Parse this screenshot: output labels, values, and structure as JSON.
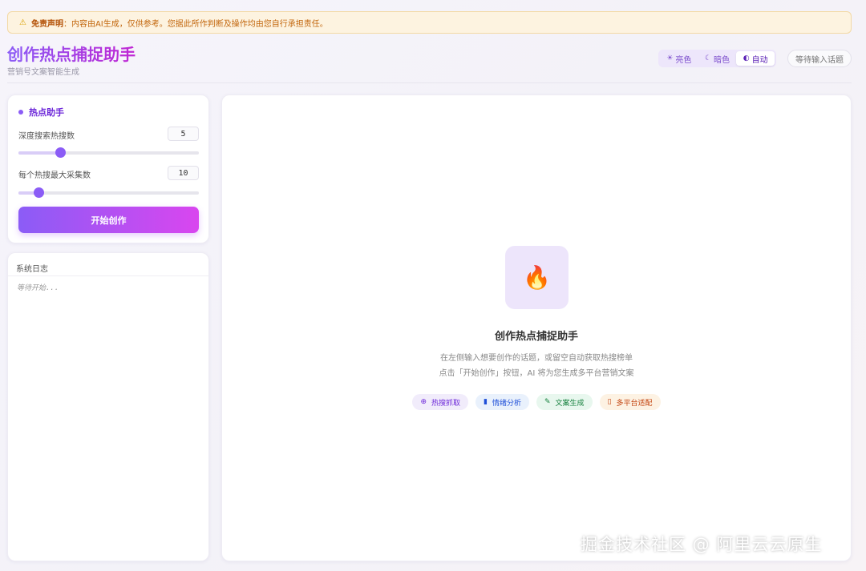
{
  "disclaimer": {
    "label": "免责声明",
    "text": "：内容由AI生成，仅供参考。您据此所作判断及操作均由您自行承担责任。"
  },
  "header": {
    "title": "创作热点捕捉助手",
    "subtitle": "营销号文案智能生成",
    "themes": [
      {
        "label": "亮色",
        "icon": "sun-icon"
      },
      {
        "label": "暗色",
        "icon": "moon-icon"
      },
      {
        "label": "自动",
        "icon": "half-circle-icon"
      }
    ],
    "active_theme": "自动",
    "status": "等待输入话题"
  },
  "settings": {
    "title": "热点助手",
    "depth": {
      "label": "深度搜索热搜数",
      "value": "5",
      "fraction": 0.23
    },
    "max_collect": {
      "label": "每个热搜最大采集数",
      "value": "10",
      "fraction": 0.11
    },
    "start_label": "开始创作"
  },
  "log": {
    "title": "系统日志",
    "text": "等待开始..."
  },
  "main": {
    "icon": "fire-icon",
    "title": "创作热点捕捉助手",
    "desc1": "在左侧输入想要创作的话题，或留空自动获取热搜榜单",
    "desc2": "点击「开始创作」按钮，AI 将为您生成多平台营销文案",
    "features": [
      {
        "label": "热搜抓取",
        "icon": "globe-icon"
      },
      {
        "label": "情绪分析",
        "icon": "bar-chart-icon"
      },
      {
        "label": "文案生成",
        "icon": "pen-icon"
      },
      {
        "label": "多平台适配",
        "icon": "phone-icon"
      }
    ]
  },
  "watermark": "掘金技术社区 @ 阿里云云原生",
  "colors": {
    "accent": "#8b5cf6",
    "accent2": "#d946ef",
    "warning_bg": "#fdf3e0"
  }
}
